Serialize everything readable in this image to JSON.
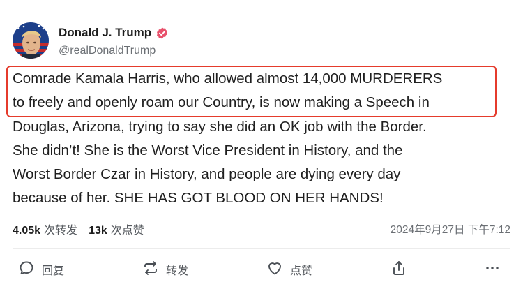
{
  "author": {
    "name": "Donald J. Trump",
    "handle": "@realDonaldTrump"
  },
  "post": {
    "lines": [
      "Comrade Kamala Harris, who allowed almost 14,000 MURDERERS",
      "to freely and openly roam our Country, is now making a Speech in",
      "Douglas, Arizona, trying to say she did an OK job with the Border.",
      "She didn’t! She is the Worst Vice President in History, and the",
      "Worst Border Czar in History, and people are dying every day",
      "because of her. SHE HAS GOT BLOOD ON HER HANDS!"
    ]
  },
  "stats": {
    "reposts_count": "4.05k",
    "reposts_label": "次转发",
    "likes_count": "13k",
    "likes_label": "次点赞",
    "timestamp": "2024年9月27日 下午7:12"
  },
  "actions": {
    "reply_label": "回复",
    "repost_label": "转发",
    "like_label": "点赞"
  },
  "colors": {
    "verified": "#e8506b",
    "highlight_border": "#e53b2c",
    "icon": "#4a4f55"
  }
}
